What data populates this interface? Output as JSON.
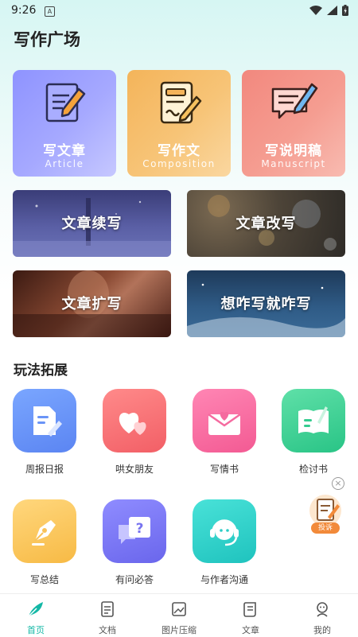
{
  "status_bar": {
    "time": "9:26",
    "notification_letter": "A"
  },
  "header": {
    "title": "写作广场"
  },
  "top_cards": [
    {
      "title": "写文章",
      "subtitle": "Article",
      "color": "#8e93ff"
    },
    {
      "title": "写作文",
      "subtitle": "Composition",
      "color": "#f4b45a"
    },
    {
      "title": "写说明稿",
      "subtitle": "Manuscript",
      "color": "#f2887e"
    }
  ],
  "banners": [
    {
      "label": "文章续写"
    },
    {
      "label": "文章改写"
    },
    {
      "label": "文章扩写"
    },
    {
      "label": "想咋写就咋写"
    }
  ],
  "section": {
    "title": "玩法拓展"
  },
  "features": [
    {
      "label": "周报日报",
      "icon": "document-edit-icon",
      "color": "#6a94f7"
    },
    {
      "label": "哄女朋友",
      "icon": "hearts-icon",
      "color": "#f46d74"
    },
    {
      "label": "写情书",
      "icon": "love-letter-icon",
      "color": "#f56a9f"
    },
    {
      "label": "检讨书",
      "icon": "notebook-icon",
      "color": "#34cc8f"
    },
    {
      "label": "写总结",
      "icon": "pen-nib-icon",
      "color": "#f8c25a"
    },
    {
      "label": "有问必答",
      "icon": "question-chat-icon",
      "color": "#7773f0"
    },
    {
      "label": "与作者沟通",
      "icon": "headset-icon",
      "color": "#2ccdc6"
    }
  ],
  "floating": {
    "tag": "投诉",
    "close": "×"
  },
  "bottom_nav": [
    {
      "label": "首页",
      "icon": "feather-icon",
      "active": true
    },
    {
      "label": "文档",
      "icon": "doc-icon",
      "active": false
    },
    {
      "label": "图片压缩",
      "icon": "image-icon",
      "active": false
    },
    {
      "label": "文章",
      "icon": "scroll-icon",
      "active": false
    },
    {
      "label": "我的",
      "icon": "user-icon",
      "active": false
    }
  ],
  "colors": {
    "accent": "#14b8a6"
  }
}
